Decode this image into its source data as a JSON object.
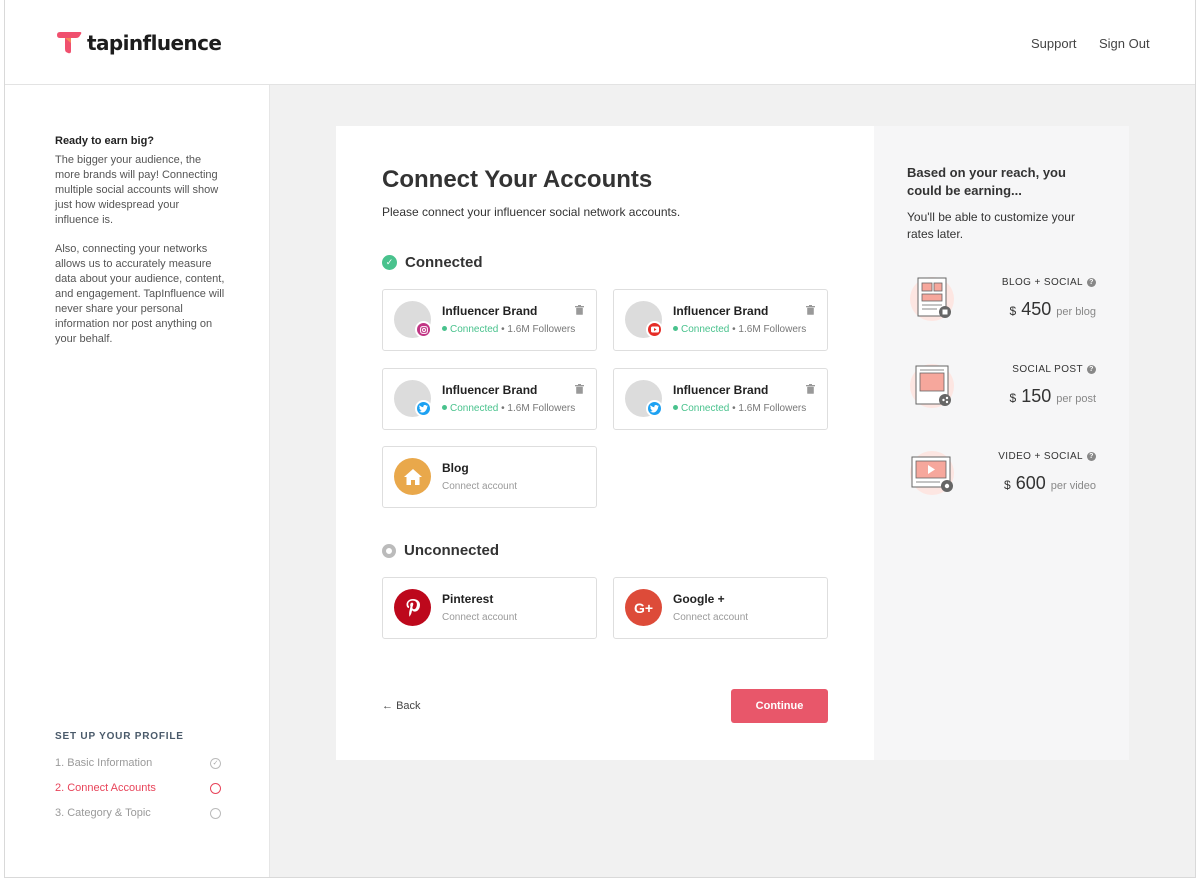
{
  "header": {
    "logo_text": "tapinfluence",
    "support": "Support",
    "sign_out": "Sign Out"
  },
  "sidebar": {
    "heading": "Ready to earn big?",
    "para1": "The bigger your audience, the more brands will pay! Connecting multiple social accounts will show just how widespread your influence is.",
    "para2": "Also, connecting your networks allows us to accurately measure data about your audience, content, and engagement. TapInfluence will never share your personal information nor post anything on your behalf.",
    "steps_title": "SET UP YOUR PROFILE",
    "steps": [
      {
        "label": "1. Basic Information",
        "state": "done"
      },
      {
        "label": "2. Connect Accounts",
        "state": "active"
      },
      {
        "label": "3. Category & Topic",
        "state": "todo"
      }
    ]
  },
  "main": {
    "title": "Connect Your Accounts",
    "subtitle": "Please connect your influencer social network accounts.",
    "connected_heading": "Connected",
    "unconnected_heading": "Unconnected",
    "connected_accounts": [
      {
        "name": "Influencer Brand",
        "network": "instagram-icon",
        "status": "Connected",
        "followers": "• 1.6M Followers"
      },
      {
        "name": "Influencer Brand",
        "network": "youtube-icon",
        "status": "Connected",
        "followers": "• 1.6M Followers"
      },
      {
        "name": "Influencer Brand",
        "network": "twitter-icon",
        "status": "Connected",
        "followers": "• 1.6M Followers"
      },
      {
        "name": "Influencer Brand",
        "network": "twitter-icon",
        "status": "Connected",
        "followers": "• 1.6M Followers"
      }
    ],
    "blog": {
      "name": "Blog",
      "action": "Connect account"
    },
    "unconnected_accounts": [
      {
        "name": "Pinterest",
        "action": "Connect account",
        "color": "#bd081c"
      },
      {
        "name": "Google +",
        "action": "Connect account",
        "color": "#dd4b39"
      }
    ],
    "back": "Back",
    "continue": "Continue"
  },
  "earnings": {
    "title": "Based on your reach, you could be earning...",
    "subtitle": "You'll be able to customize your rates later.",
    "rates": [
      {
        "label": "BLOG + SOCIAL",
        "currency": "$",
        "amount": "450",
        "unit": "per blog"
      },
      {
        "label": "SOCIAL POST",
        "currency": "$",
        "amount": "150",
        "unit": "per post"
      },
      {
        "label": "VIDEO + SOCIAL",
        "currency": "$",
        "amount": "600",
        "unit": "per video"
      }
    ]
  },
  "colors": {
    "accent": "#e8576a",
    "connected": "#49c28d",
    "instagram": "#c13584",
    "youtube": "#e52d27",
    "twitter": "#1da1f2",
    "blog": "#e9a84b"
  }
}
